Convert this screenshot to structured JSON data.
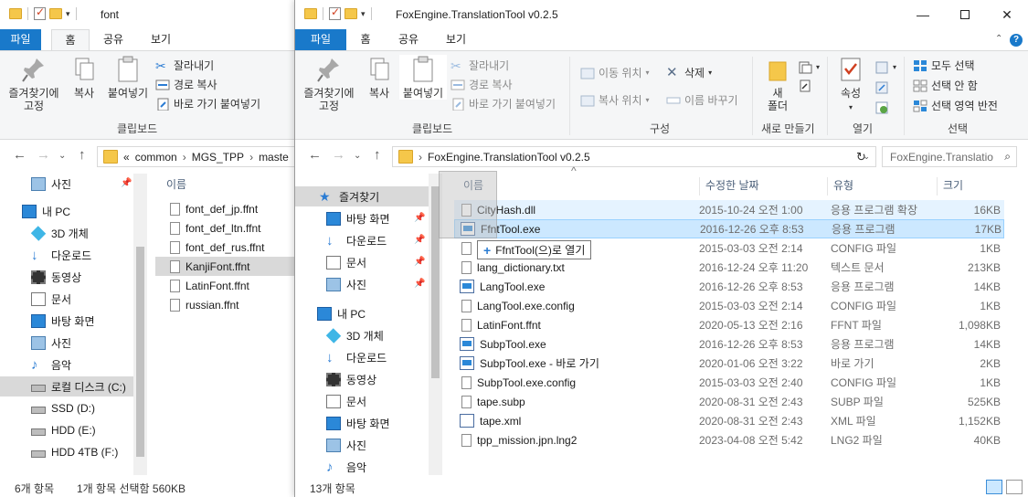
{
  "colors": {
    "accent": "#1979ca",
    "selection": "#cce8ff",
    "folder": "#f5c74a"
  },
  "back_window": {
    "title": "font",
    "tabs": [
      "파일",
      "홈",
      "공유",
      "보기"
    ],
    "ribbon": {
      "pin_label_1": "즐겨찾기에",
      "pin_label_2": "고정",
      "copy": "복사",
      "paste": "붙여넣기",
      "cut": "잘라내기",
      "copy_path": "경로 복사",
      "paste_shortcut": "바로 가기 붙여넣기",
      "group_clipboard": "클립보드"
    },
    "breadcrumb": [
      "«",
      "common",
      "MGS_TPP",
      "maste"
    ],
    "nav": [
      {
        "label": "사진",
        "icon": "pictures-icon",
        "pinned": true
      },
      {
        "label": "내 PC",
        "icon": "pc-icon"
      },
      {
        "label": "3D 개체",
        "icon": "3d-objects-icon"
      },
      {
        "label": "다운로드",
        "icon": "download-icon"
      },
      {
        "label": "동영상",
        "icon": "video-icon"
      },
      {
        "label": "문서",
        "icon": "documents-icon"
      },
      {
        "label": "바탕 화면",
        "icon": "desktop-icon"
      },
      {
        "label": "사진",
        "icon": "pictures-icon"
      },
      {
        "label": "음악",
        "icon": "music-icon"
      },
      {
        "label": "로컬 디스크 (C:)",
        "icon": "drive-icon",
        "selected": true
      },
      {
        "label": "SSD (D:)",
        "icon": "drive-icon"
      },
      {
        "label": "HDD (E:)",
        "icon": "drive-icon"
      },
      {
        "label": "HDD 4TB (F:)",
        "icon": "drive-icon"
      }
    ],
    "column_name": "이름",
    "files": [
      "font_def_jp.ffnt",
      "font_def_ltn.ffnt",
      "font_def_rus.ffnt",
      "KanjiFont.ffnt",
      "LatinFont.ffnt",
      "russian.ffnt"
    ],
    "selected_file": "KanjiFont.ffnt",
    "status": {
      "count": "6개 항목",
      "selection": "1개 항목 선택함 560KB"
    }
  },
  "front_window": {
    "title": "FoxEngine.TranslationTool v0.2.5",
    "tabs": [
      "파일",
      "홈",
      "공유",
      "보기"
    ],
    "ribbon": {
      "pin_label_1": "즐겨찾기에",
      "pin_label_2": "고정",
      "copy": "복사",
      "paste": "붙여넣기",
      "cut": "잘라내기",
      "copy_path": "경로 복사",
      "paste_shortcut": "바로 가기 붙여넣기",
      "group_clipboard": "클립보드",
      "move_to": "이동 위치",
      "copy_to": "복사 위치",
      "delete": "삭제",
      "rename": "이름 바꾸기",
      "group_organize": "구성",
      "new_folder_1": "새",
      "new_folder_2": "폴더",
      "group_new": "새로 만들기",
      "properties": "속성",
      "group_open": "열기",
      "select_all": "모두 선택",
      "select_none": "선택 안 함",
      "invert_selection": "선택 영역 반전",
      "group_select": "선택"
    },
    "address": "FoxEngine.TranslationTool v0.2.5",
    "search_placeholder": "FoxEngine.Translatio",
    "nav": [
      {
        "label": "즐겨찾기",
        "icon": "star-icon",
        "selected": true
      },
      {
        "label": "바탕 화면",
        "icon": "desktop-icon",
        "pinned": true
      },
      {
        "label": "다운로드",
        "icon": "download-icon",
        "pinned": true
      },
      {
        "label": "문서",
        "icon": "documents-icon",
        "pinned": true
      },
      {
        "label": "사진",
        "icon": "pictures-icon",
        "pinned": true
      },
      {
        "label": "내 PC",
        "icon": "pc-icon"
      },
      {
        "label": "3D 개체",
        "icon": "3d-objects-icon"
      },
      {
        "label": "다운로드",
        "icon": "download-icon"
      },
      {
        "label": "동영상",
        "icon": "video-icon"
      },
      {
        "label": "문서",
        "icon": "documents-icon"
      },
      {
        "label": "바탕 화면",
        "icon": "desktop-icon"
      },
      {
        "label": "사진",
        "icon": "pictures-icon"
      },
      {
        "label": "음악",
        "icon": "music-icon"
      }
    ],
    "columns": {
      "name": "이름",
      "date": "수정한 날짜",
      "type": "유형",
      "size": "크기"
    },
    "files": [
      {
        "name": "CityHash.dll",
        "date": "2015-10-24 오전 1:00",
        "type": "응용 프로그램 확장",
        "size": "16KB",
        "icon": "dll-icon",
        "state": "hover"
      },
      {
        "name": "FfntTool.exe",
        "date": "2016-12-26 오후 8:53",
        "type": "응용 프로그램",
        "size": "17KB",
        "icon": "exe-icon",
        "state": "selected"
      },
      {
        "name": "FfntTool.exe.config",
        "date": "2015-03-03 오전 2:14",
        "type": "CONFIG 파일",
        "size": "1KB",
        "icon": "file-icon"
      },
      {
        "name": "lang_dictionary.txt",
        "date": "2016-12-24 오후 11:20",
        "type": "텍스트 문서",
        "size": "213KB",
        "icon": "file-icon"
      },
      {
        "name": "LangTool.exe",
        "date": "2016-12-26 오후 8:53",
        "type": "응용 프로그램",
        "size": "14KB",
        "icon": "exe-icon"
      },
      {
        "name": "LangTool.exe.config",
        "date": "2015-03-03 오전 2:14",
        "type": "CONFIG 파일",
        "size": "1KB",
        "icon": "file-icon"
      },
      {
        "name": "LatinFont.ffnt",
        "date": "2020-05-13 오전 2:16",
        "type": "FFNT 파일",
        "size": "1,098KB",
        "icon": "file-icon"
      },
      {
        "name": "SubpTool.exe",
        "date": "2016-12-26 오후 8:53",
        "type": "응용 프로그램",
        "size": "14KB",
        "icon": "exe-icon"
      },
      {
        "name": "SubpTool.exe - 바로 가기",
        "date": "2020-01-06 오전 3:22",
        "type": "바로 가기",
        "size": "2KB",
        "icon": "shortcut-icon"
      },
      {
        "name": "SubpTool.exe.config",
        "date": "2015-03-03 오전 2:40",
        "type": "CONFIG 파일",
        "size": "1KB",
        "icon": "file-icon"
      },
      {
        "name": "tape.subp",
        "date": "2020-08-31 오전 2:43",
        "type": "SUBP 파일",
        "size": "525KB",
        "icon": "file-icon"
      },
      {
        "name": "tape.xml",
        "date": "2020-08-31 오전 2:43",
        "type": "XML 파일",
        "size": "1,152KB",
        "icon": "xml-icon"
      },
      {
        "name": "tpp_mission.jpn.lng2",
        "date": "2023-04-08 오전 5:42",
        "type": "LNG2 파일",
        "size": "40KB",
        "icon": "file-icon"
      }
    ],
    "drag_tooltip": "FfntTool(으)로 열기",
    "status": {
      "count": "13개 항목"
    }
  }
}
